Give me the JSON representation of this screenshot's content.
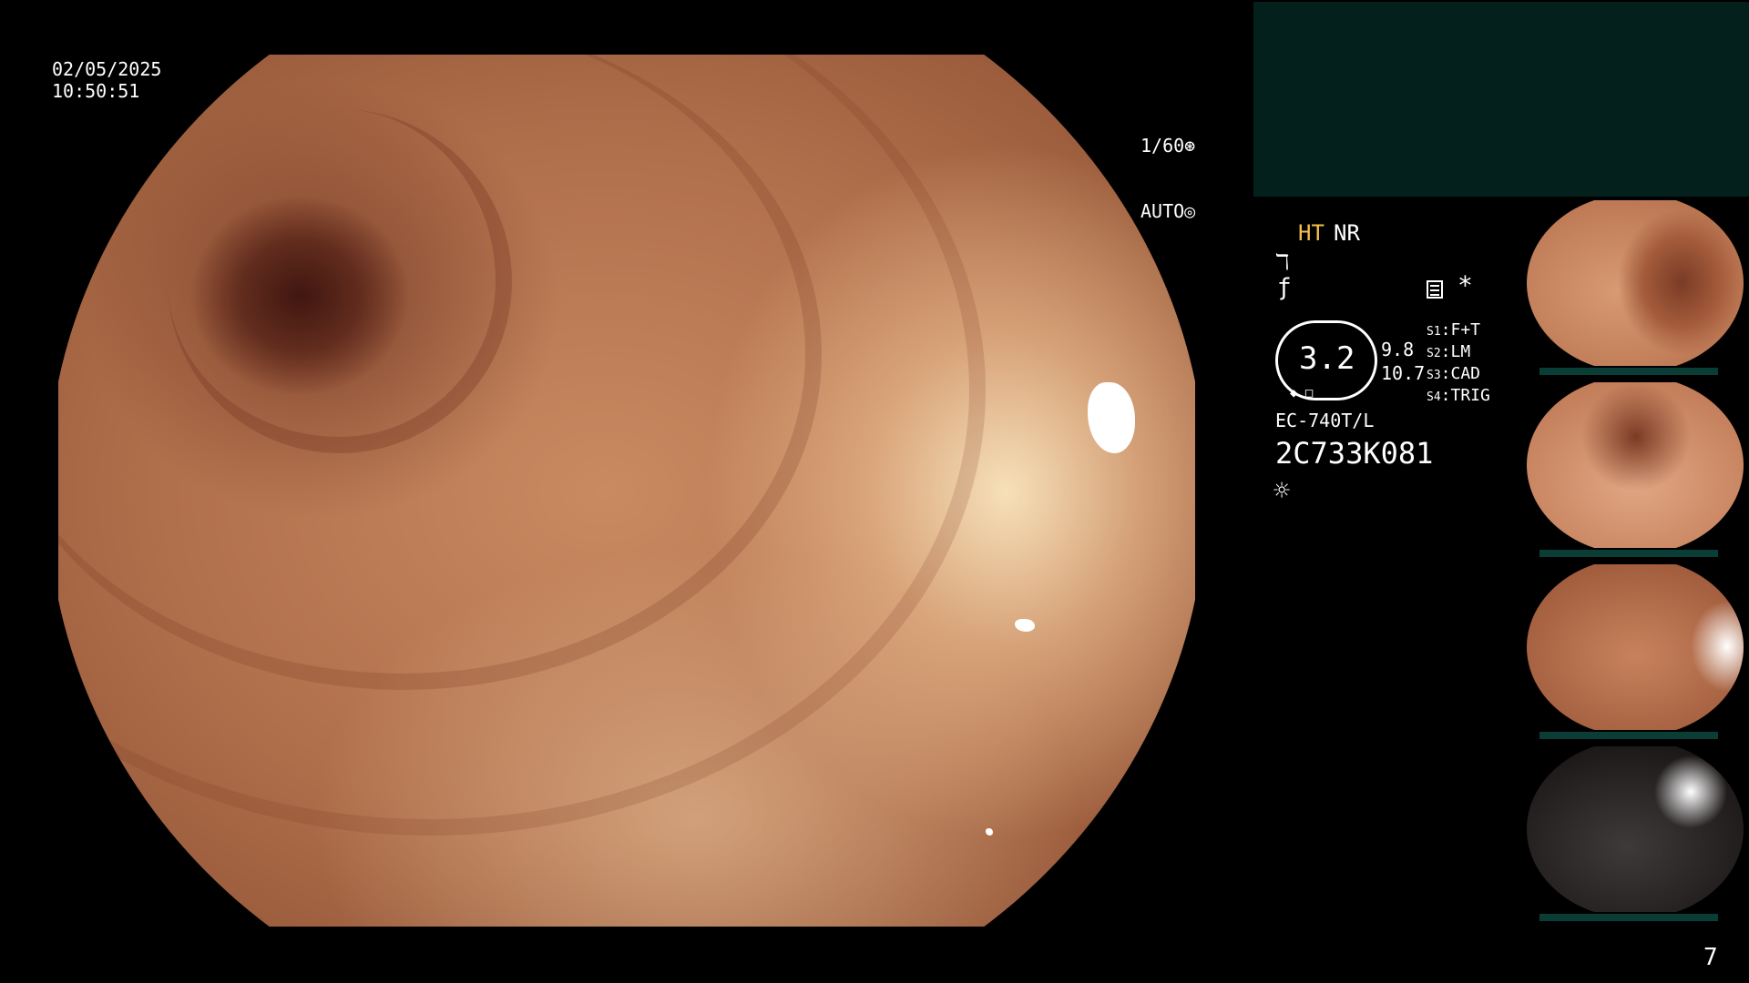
{
  "overlay": {
    "date": "02/05/2025",
    "time": "10:50:51",
    "shutter": "1/60",
    "exposure": "AUTO"
  },
  "sidebar": {
    "mode_ht": "HT",
    "mode_nr": "NR",
    "zoom_value": "3.2",
    "value_a": "9.8",
    "value_b": "10.7",
    "switches": [
      {
        "key": "S1",
        "value": "F+T"
      },
      {
        "key": "S2",
        "value": "LM"
      },
      {
        "key": "S3",
        "value": "CAD"
      },
      {
        "key": "S4",
        "value": "TRIG"
      }
    ],
    "scope_model": "EC-740T/L",
    "scope_serial": "2C733K081"
  },
  "page_number": "7",
  "colors": {
    "ht_label": "#f5c04a",
    "panel": "#03201d"
  },
  "icons": {
    "shutter": "aperture-icon",
    "exposure": "auto-exposure-icon",
    "list": "list-icon",
    "light": "sun-icon"
  }
}
